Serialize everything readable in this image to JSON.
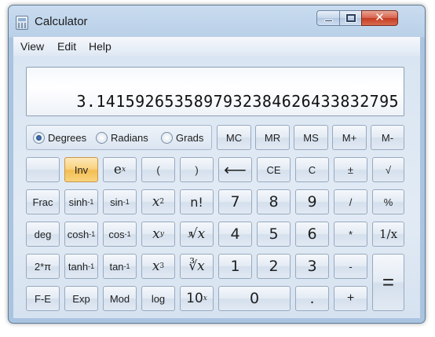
{
  "window": {
    "title": "Calculator"
  },
  "menu": {
    "view": "View",
    "edit": "Edit",
    "help": "Help"
  },
  "display": {
    "value": "3.1415926535897932384626433832795"
  },
  "angle_mode": {
    "selected": "Degrees",
    "options": [
      "Degrees",
      "Radians",
      "Grads"
    ]
  },
  "buttons": {
    "mc": "MC",
    "mr": "MR",
    "ms": "MS",
    "mplus": "M+",
    "mminus": "M-",
    "inv": "Inv",
    "ex_base": "e",
    "ex_sup": "x",
    "lparen": "(",
    "rparen": ")",
    "backspace": "⟵",
    "ce": "CE",
    "c": "C",
    "plusminus": "±",
    "sqrt": "√",
    "frac": "Frac",
    "sinh": "sinh",
    "sinh_sup": "-1",
    "sin": "sin",
    "sin_sup": "-1",
    "x2_base": "x",
    "x2_sup": "2",
    "fact": "n!",
    "d7": "7",
    "d8": "8",
    "d9": "9",
    "divide": "/",
    "percent": "%",
    "deg": "deg",
    "cosh": "cosh",
    "cosh_sup": "-1",
    "cos": "cos",
    "cos_sup": "-1",
    "xy_base": "x",
    "xy_sup": "y",
    "yroot_pre": "y",
    "yroot_main": "√x",
    "d4": "4",
    "d5": "5",
    "d6": "6",
    "multiply": "*",
    "reciprocal": "1/x",
    "twopi": "2*π",
    "tanh": "tanh",
    "tanh_sup": "-1",
    "tan": "tan",
    "tan_sup": "-1",
    "x3_base": "x",
    "x3_sup": "3",
    "cuberoot": "∛x",
    "d1": "1",
    "d2": "2",
    "d3": "3",
    "minus": "-",
    "equals": "=",
    "fe": "F-E",
    "exp": "Exp",
    "mod": "Mod",
    "log": "log",
    "tenx_base": "10",
    "tenx_sup": "x",
    "d0": "0",
    "dot": ".",
    "plus": "+"
  },
  "colors": {
    "accent": "#f3bd52",
    "window_frame": "#aac4e0",
    "close": "#c43b23"
  },
  "icons": [
    "calculator-icon",
    "minimize-icon",
    "maximize-icon",
    "close-icon",
    "backspace-icon"
  ]
}
